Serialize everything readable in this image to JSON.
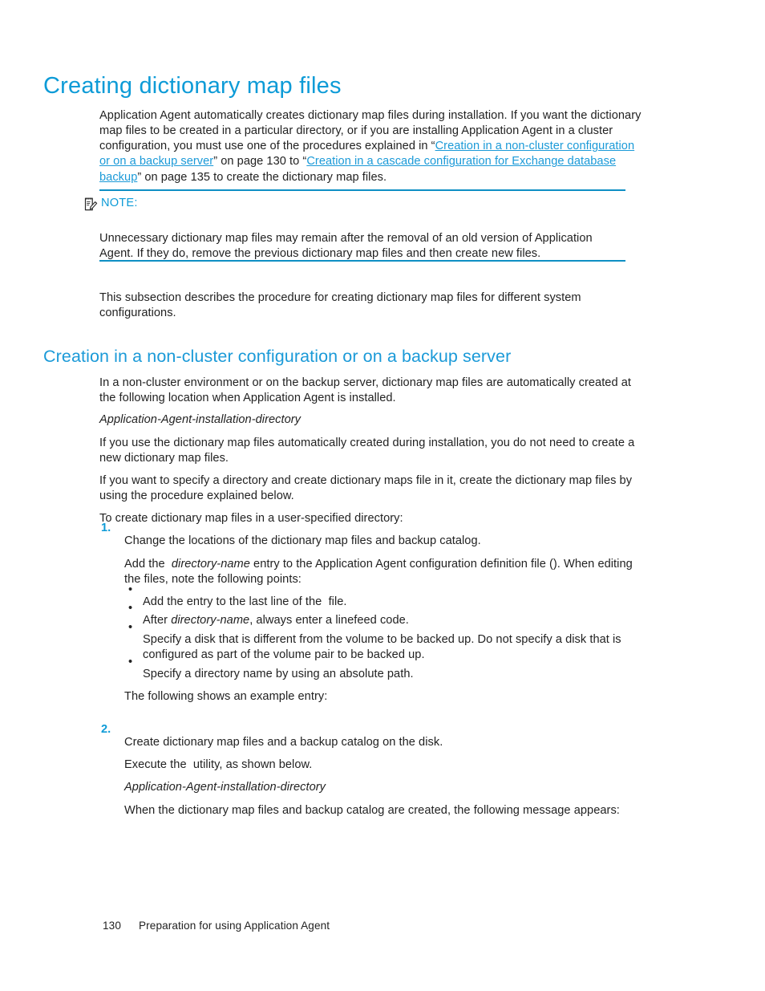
{
  "colors": {
    "accent_blue": "#0d9bd7",
    "link_blue": "#1b9ad8",
    "rule_blue": "#0e8fc4",
    "body_text": "#222222",
    "page_background": "#ffffff"
  },
  "title": "Creating dictionary map files",
  "intro": {
    "part1": "Application Agent automatically creates dictionary map files during installation. If you want the dictionary map files to be created in a particular directory, or if you are installing Application Agent in a cluster configuration, you must use one of the procedures explained in “",
    "link1": "Creation in a non-cluster configuration or on a backup server",
    "part2": "” on page 130 to “",
    "link2": "Creation in a cascade configuration for Exchange database backup",
    "part3": "” on page 135 to create the dictionary map files."
  },
  "note": {
    "icon": "note-pencil-icon",
    "label": "NOTE:",
    "body": "Unnecessary dictionary map files may remain after the removal of an old version of Application Agent. If they do, remove the previous dictionary map files and then create new files."
  },
  "subsection_intro": "This subsection describes the procedure for creating dictionary map files for different system configurations.",
  "section": {
    "heading": "Creation in a non-cluster configuration or on a backup server",
    "para1": "In a non-cluster environment or on the backup server, dictionary map files are automatically created at the following location when Application Agent is installed.",
    "path_italic": "Application-Agent-installation-directory",
    "para2": "If you use the dictionary map files automatically created during installation, you do not need to create a new dictionary map files.",
    "para3": "If you want to specify a directory and create dictionary maps file in it, create the dictionary map files by using the procedure explained below.",
    "para4": "To create dictionary map files in a user-specified directory:"
  },
  "steps": [
    {
      "number": "1.",
      "text": "Change the locations of the dictionary map files and backup catalog.",
      "detail_a": "Add the",
      "detail_code1": "                    ",
      "detail_b_italic": "directory-name",
      "detail_c": "entry to the Application Agent configuration definition file (",
      "detail_code2": "            ",
      "detail_d": "). When editing the files, note the following points:",
      "bullets": [
        {
          "text_a": "Add the entry to the last line of the",
          "code": "             ",
          "text_b": "file."
        },
        {
          "text_a": "After",
          "italic": "directory-name",
          "text_b": ", always enter a linefeed code."
        },
        {
          "text_a": "Specify a disk that is different from the volume to be backed up. Do not specify a disk that is configured as part of the volume pair to be backed up."
        },
        {
          "text_a": "Specify a directory name by using an absolute path."
        }
      ],
      "closing": "The following shows an example entry:",
      "example_block": "                                          "
    },
    {
      "number": "2.",
      "text": "Create dictionary map files and a backup catalog on the disk.",
      "detail_a": "Execute the",
      "detail_code1": "                 ",
      "detail_b": "utility, as shown below.",
      "command_code": "          ",
      "command_italic": "Application-Agent-installation-directory",
      "closing": "When the dictionary map files and backup catalog are created, the following message appears:",
      "message_block": "                                  "
    }
  ],
  "footer": {
    "page_number": "130",
    "chapter_title": "Preparation for using Application Agent"
  }
}
